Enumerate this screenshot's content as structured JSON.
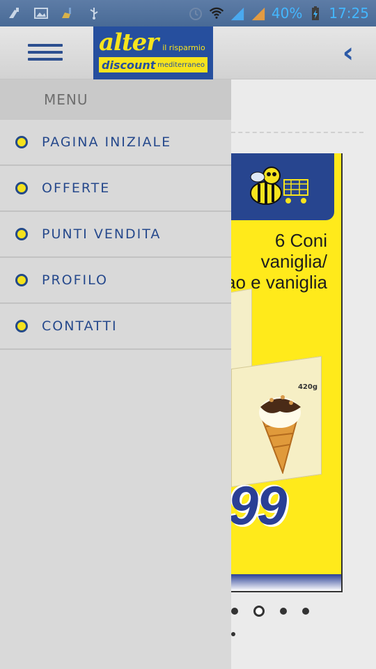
{
  "status_bar": {
    "left_icons": [
      "cleaner-icon",
      "image-icon",
      "broom-icon",
      "usb-icon"
    ],
    "right_icons": [
      "alarm-icon",
      "wifi-icon",
      "signal-icon",
      "signal-icon-2",
      "battery-charging-icon"
    ],
    "battery": "40%",
    "time": "17:25"
  },
  "header": {
    "menu_icon": "hamburger-icon",
    "logo": {
      "brand": "alter",
      "tag_top": "il risparmio",
      "discount": "discount",
      "tag_bottom": "mediterraneo"
    },
    "back_icon": "chevron-left-icon"
  },
  "drawer": {
    "title": "MENU",
    "items": [
      {
        "label": "PAGINA INIZIALE"
      },
      {
        "label": "OFFERTE"
      },
      {
        "label": "PUNTI VENDITA"
      },
      {
        "label": "PROFILO"
      },
      {
        "label": "CONTATTI"
      }
    ]
  },
  "promo": {
    "title_lines": [
      "6 Coni",
      "vaniglia/",
      "ao e vaniglia"
    ],
    "weight": "420g",
    "price": ",99"
  },
  "carousel": {
    "active_index": 1,
    "dot_count": 4
  },
  "colors": {
    "brand_blue": "#264f9e",
    "brand_yellow": "#f7e41d",
    "menu_text": "#26498c"
  }
}
